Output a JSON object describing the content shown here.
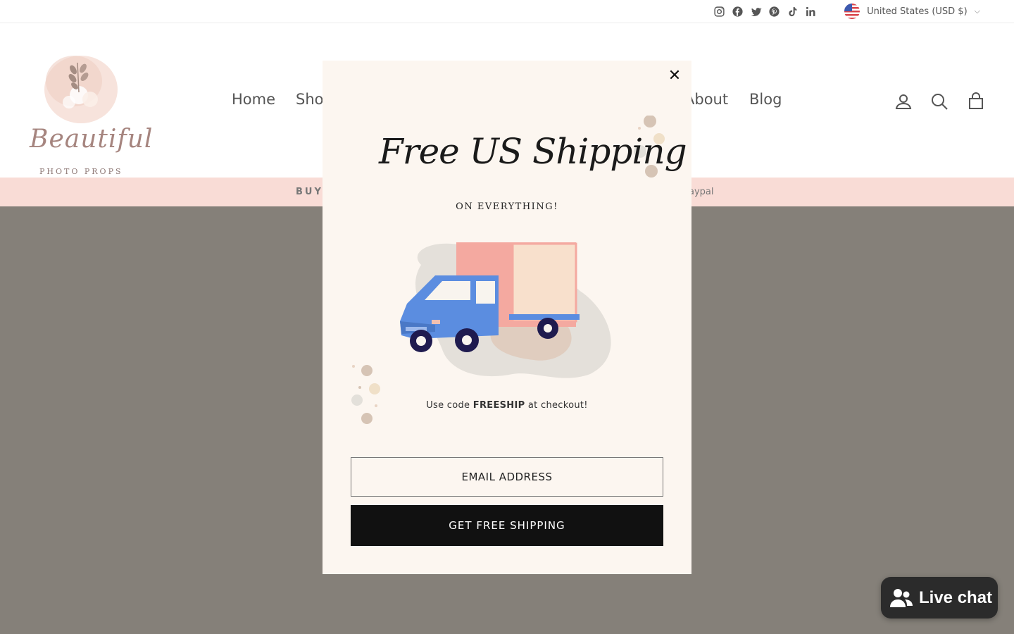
{
  "topbar": {
    "socials": [
      "instagram-icon",
      "facebook-icon",
      "twitter-icon",
      "pinterest-icon",
      "tiktok-icon",
      "linkedin-icon"
    ],
    "currency_label": "United States (USD $)"
  },
  "header": {
    "logo_script": "Beautiful",
    "logo_sub": "PHOTO PROPS",
    "nav": {
      "home": "Home",
      "shop": "Sho",
      "about": "About",
      "blog": "Blog"
    }
  },
  "announce": {
    "left": "BUY",
    "right": "aypal"
  },
  "modal": {
    "headline": "Free US Shipping",
    "subhead": "ON EVERYTHING!",
    "promo_prefix": "Use code ",
    "promo_code": "FREESHIP",
    "promo_suffix": " at checkout!",
    "email_placeholder": "EMAIL ADDRESS",
    "cta_label": "GET FREE SHIPPING",
    "close_symbol": "✕"
  },
  "livechat": {
    "label": "Live chat"
  },
  "colors": {
    "page_overlay": "#858079",
    "modal_bg": "#fcf6f0",
    "announce_bg": "#f9dcd6",
    "cta_bg": "#111111",
    "truck_body": "#5b8de0",
    "truck_box": "#f4a9a0"
  }
}
